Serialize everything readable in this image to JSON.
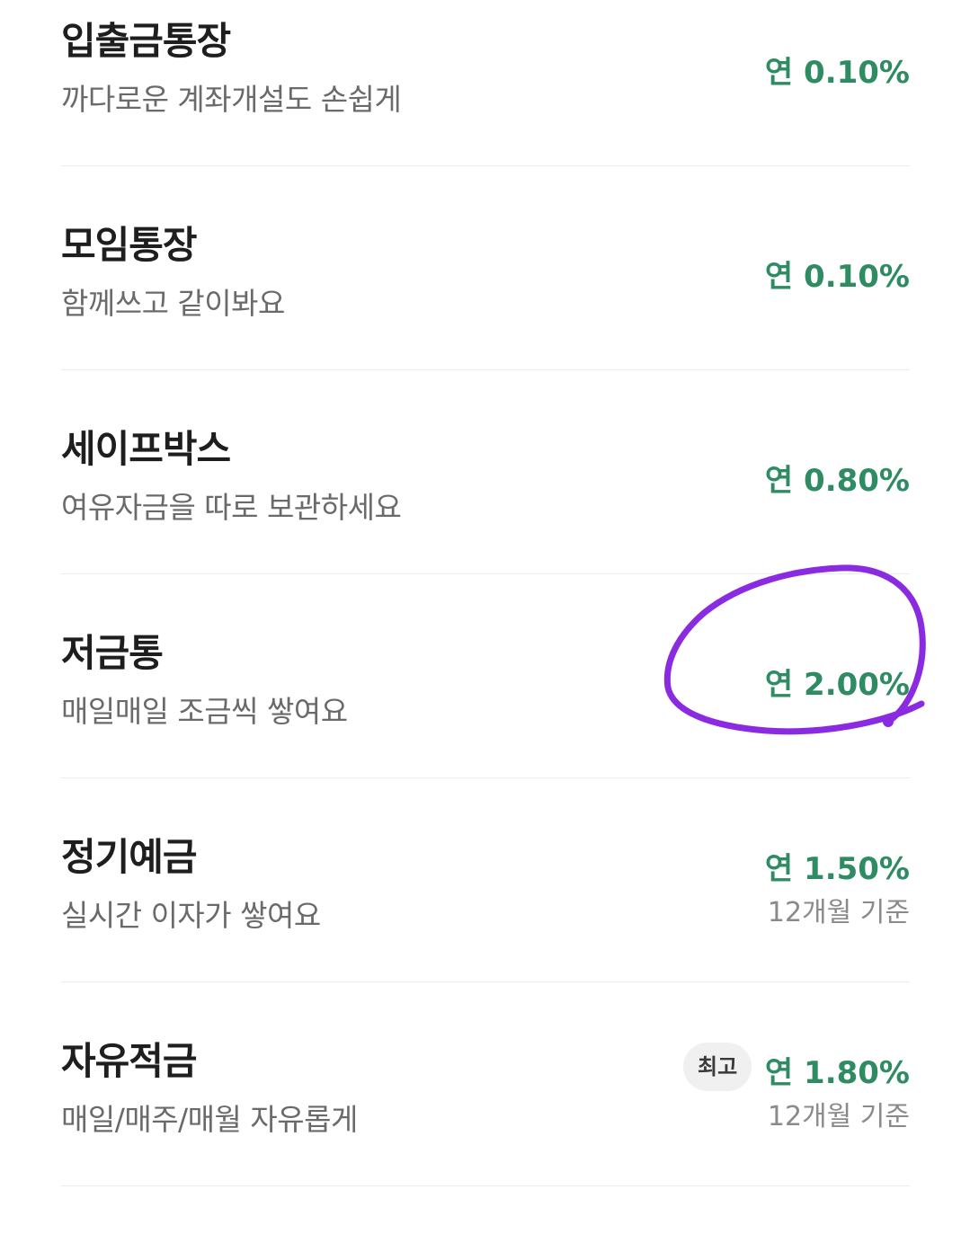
{
  "accounts": [
    {
      "title": "입출금통장",
      "subtitle": "까다로운 계좌개설도 손쉽게",
      "rate": "연 0.10%"
    },
    {
      "title": "모임통장",
      "subtitle": "함께쓰고 같이봐요",
      "rate": "연 0.10%"
    },
    {
      "title": "세이프박스",
      "subtitle": "여유자금을 따로 보관하세요",
      "rate": "연 0.80%"
    },
    {
      "title": "저금통",
      "subtitle": "매일매일 조금씩 쌓여요",
      "rate": "연 2.00%"
    },
    {
      "title": "정기예금",
      "subtitle": "실시간 이자가 쌓여요",
      "rate": "연 1.50%",
      "period": "12개월 기준"
    },
    {
      "title": "자유적금",
      "subtitle": "매일/매주/매월 자유롭게",
      "rate": "연 1.80%",
      "period": "12개월 기준",
      "badge": "최고"
    }
  ],
  "colors": {
    "rate_green": "#2e8b62",
    "annotation_purple": "#8a2be2",
    "divider": "#ececec"
  }
}
